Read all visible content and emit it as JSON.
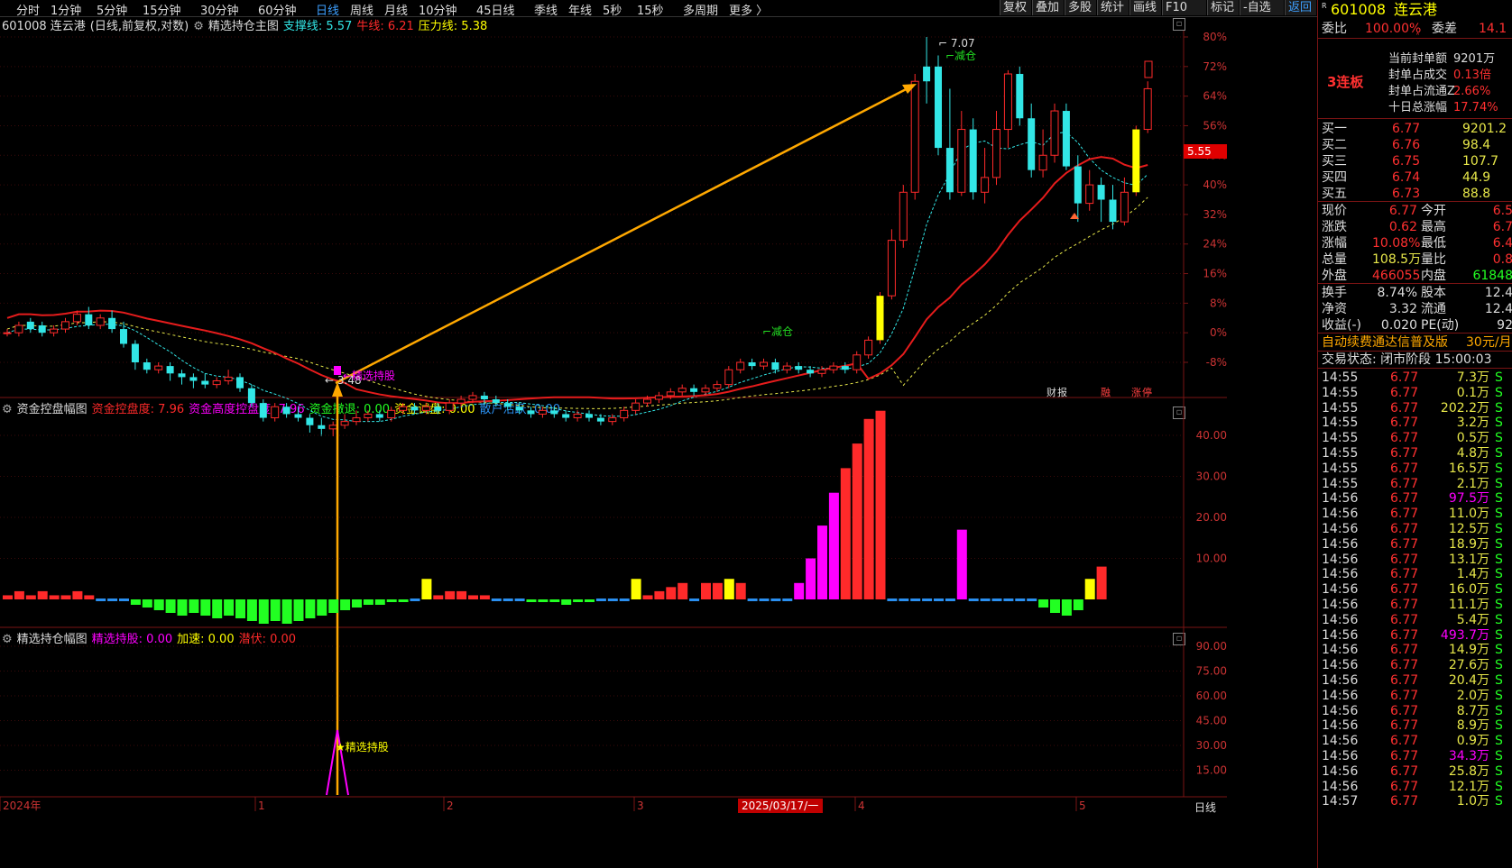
{
  "topbar": {
    "periods": [
      "分时",
      "1分钟",
      "5分钟",
      "15分钟",
      "30分钟",
      "60分钟",
      "日线",
      "周线",
      "月线",
      "10分钟",
      "45日线",
      "季线",
      "年线",
      "5秒",
      "15秒",
      "多周期",
      "更多 〉"
    ],
    "active_period": "日线",
    "tools": [
      "复权",
      "叠加",
      "多股",
      "统计",
      "画线",
      "F10",
      "标记",
      "-自选",
      "返回"
    ]
  },
  "main_title": {
    "stock": "601008 连云港",
    "mode": "(日线,前复权,对数)",
    "indicator": "精选持仓主图",
    "support": "支撑线: 5.57",
    "bull": "牛线: 6.21",
    "pressure": "压力线: 5.38"
  },
  "main_y_labels": [
    "80%",
    "72%",
    "64%",
    "56%",
    "48%",
    "40%",
    "32%",
    "24%",
    "16%",
    "8%",
    "0%",
    "-8%"
  ],
  "current_price_tag": "5.55",
  "annotations": {
    "high": "7.07",
    "low": "3.48",
    "reduce1": "减仓",
    "reduce2": "减仓",
    "hold": "精选持股",
    "icon_caibao": "财",
    "icon_rong": "融",
    "icon_zt": "涨",
    "icon_star": "★精选持股"
  },
  "ind1_title": {
    "name": "资金控盘幅图",
    "a": "资金控盘度: 7.96",
    "b": "资金高度控盘度: 7.96",
    "c": "资金撤退: 0.00",
    "d": "资金试盘: 0.00",
    "e": "散户活跃: 0.00"
  },
  "ind1_y_labels": [
    "40.00",
    "30.00",
    "20.00",
    "10.00"
  ],
  "ind2_title": {
    "name": "精选持仓幅图",
    "a": "精选持股: 0.00",
    "b": "加速: 0.00",
    "c": "潜伏: 0.00"
  },
  "ind2_y_labels": [
    "90.00",
    "75.00",
    "60.00",
    "45.00",
    "30.00",
    "15.00"
  ],
  "x_axis": {
    "labels": [
      "2024年",
      "1",
      "2",
      "3",
      "2025/03/17/一",
      "4",
      "5"
    ],
    "period_label": "日线"
  },
  "colors": {
    "up": "#ff2a2a",
    "down": "#32e6e6",
    "yellow": "#ffff00",
    "magenta": "#ff00ff",
    "green": "#22ff22",
    "blue": "#2a8ff0",
    "gold": "#ffa800",
    "bull": "#e61c1c"
  },
  "chart_data": {
    "type": "candlestick",
    "ma_labels": {
      "support": 5.57,
      "bull": 6.21,
      "pressure": 5.38
    },
    "high": 7.07,
    "low": 3.48,
    "y_pct_ticks": [
      80,
      72,
      64,
      56,
      48,
      40,
      32,
      24,
      16,
      8,
      0,
      -8
    ],
    "candles": [
      [
        0,
        0,
        0,
        1,
        -1,
        1
      ],
      [
        1,
        0,
        2,
        3,
        -1,
        1
      ],
      [
        2,
        3,
        1,
        4,
        0,
        0
      ],
      [
        3,
        2,
        0,
        3,
        -1,
        0
      ],
      [
        4,
        0,
        1,
        2,
        -1,
        1
      ],
      [
        5,
        1,
        3,
        4,
        0,
        1
      ],
      [
        6,
        3,
        5,
        6,
        2,
        1
      ],
      [
        7,
        5,
        2,
        7,
        1,
        0
      ],
      [
        8,
        2,
        4,
        5,
        1,
        1
      ],
      [
        9,
        4,
        1,
        6,
        0,
        0
      ],
      [
        10,
        1,
        -3,
        3,
        -4,
        0
      ],
      [
        11,
        -3,
        -8,
        -2,
        -10,
        0
      ],
      [
        12,
        -8,
        -10,
        -7,
        -11,
        0
      ],
      [
        13,
        -10,
        -9,
        -8,
        -11,
        1
      ],
      [
        14,
        -9,
        -11,
        -8,
        -13,
        0
      ],
      [
        15,
        -11,
        -12,
        -10,
        -14,
        0
      ],
      [
        16,
        -12,
        -13,
        -11,
        -15,
        0
      ],
      [
        17,
        -13,
        -14,
        -11,
        -15,
        0
      ],
      [
        18,
        -14,
        -13,
        -12,
        -15,
        1
      ],
      [
        19,
        -13,
        -12,
        -10,
        -14,
        1
      ],
      [
        20,
        -12,
        -15,
        -11,
        -16,
        0
      ],
      [
        21,
        -15,
        -19,
        -14,
        -20,
        0
      ],
      [
        22,
        -19,
        -23,
        -18,
        -24,
        0
      ],
      [
        23,
        -23,
        -20,
        -19,
        -24,
        1
      ],
      [
        24,
        -20,
        -22,
        -19,
        -23,
        0
      ],
      [
        25,
        -22,
        -23,
        -20,
        -24,
        0
      ],
      [
        26,
        -23,
        -25,
        -22,
        -27,
        0
      ],
      [
        27,
        -25,
        -26,
        -23,
        -28,
        0
      ],
      [
        28,
        -26,
        -25,
        -24,
        -28,
        1
      ],
      [
        29,
        -25,
        -24,
        -22,
        -26,
        1
      ],
      [
        30,
        -24,
        -23,
        -21,
        -25,
        1
      ],
      [
        31,
        -23,
        -22,
        -21,
        -24,
        1
      ],
      [
        32,
        -22,
        -23,
        -21,
        -24,
        0
      ],
      [
        33,
        -23,
        -21,
        -20,
        -24,
        1
      ],
      [
        34,
        -21,
        -20,
        -19,
        -22,
        1
      ],
      [
        35,
        -20,
        -21,
        -19,
        -22,
        0
      ],
      [
        36,
        -21,
        -20,
        -19,
        -22,
        1
      ],
      [
        37,
        -20,
        -21,
        -19,
        -22,
        0
      ],
      [
        38,
        -21,
        -19,
        -18,
        -22,
        1
      ],
      [
        39,
        -19,
        -18,
        -17,
        -20,
        1
      ],
      [
        40,
        -18,
        -17,
        -16,
        -19,
        1
      ],
      [
        41,
        -17,
        -18,
        -16,
        -19,
        0
      ],
      [
        42,
        -18,
        -19,
        -17,
        -20,
        0
      ],
      [
        43,
        -19,
        -20,
        -18,
        -21,
        0
      ],
      [
        44,
        -20,
        -21,
        -19,
        -22,
        0
      ],
      [
        45,
        -21,
        -22,
        -20,
        -23,
        0
      ],
      [
        46,
        -22,
        -21,
        -20,
        -23,
        1
      ],
      [
        47,
        -21,
        -22,
        -20,
        -23,
        0
      ],
      [
        48,
        -22,
        -23,
        -21,
        -24,
        0
      ],
      [
        49,
        -23,
        -22,
        -21,
        -24,
        1
      ],
      [
        50,
        -22,
        -23,
        -21,
        -24,
        0
      ],
      [
        51,
        -23,
        -24,
        -22,
        -25,
        0
      ],
      [
        52,
        -24,
        -23,
        -22,
        -25,
        1
      ],
      [
        53,
        -23,
        -21,
        -20,
        -24,
        1
      ],
      [
        54,
        -21,
        -19,
        -18,
        -22,
        1
      ],
      [
        55,
        -19,
        -18,
        -17,
        -20,
        1
      ],
      [
        56,
        -18,
        -17,
        -16,
        -19,
        1
      ],
      [
        57,
        -17,
        -16,
        -15,
        -18,
        1
      ],
      [
        58,
        -16,
        -15,
        -14,
        -17,
        1
      ],
      [
        59,
        -15,
        -16,
        -14,
        -17,
        0
      ],
      [
        60,
        -16,
        -15,
        -14,
        -17,
        1
      ],
      [
        61,
        -15,
        -14,
        -13,
        -16,
        1
      ],
      [
        62,
        -14,
        -10,
        -9,
        -15,
        1
      ],
      [
        63,
        -10,
        -8,
        -7,
        -11,
        1
      ],
      [
        64,
        -8,
        -9,
        -7,
        -10,
        0
      ],
      [
        65,
        -9,
        -8,
        -7,
        -10,
        1
      ],
      [
        66,
        -8,
        -10,
        -7,
        -11,
        0
      ],
      [
        67,
        -10,
        -9,
        -8,
        -11,
        1
      ],
      [
        68,
        -9,
        -10,
        -8,
        -11,
        0
      ],
      [
        69,
        -10,
        -11,
        -9,
        -12,
        0
      ],
      [
        70,
        -11,
        -10,
        -9,
        -12,
        1
      ],
      [
        71,
        -10,
        -9,
        -8,
        -11,
        1
      ],
      [
        72,
        -9,
        -10,
        -8,
        -11,
        0
      ],
      [
        73,
        -10,
        -6,
        -5,
        -11,
        1
      ],
      [
        74,
        -6,
        -2,
        -1,
        -7,
        1
      ],
      [
        75,
        -2,
        10,
        11,
        -3,
        1
      ],
      [
        76,
        10,
        25,
        28,
        9,
        1
      ],
      [
        77,
        25,
        38,
        40,
        23,
        1
      ],
      [
        78,
        38,
        68,
        70,
        36,
        1
      ],
      [
        79,
        68,
        72,
        80,
        62,
        0
      ],
      [
        80,
        72,
        50,
        75,
        48,
        0
      ],
      [
        81,
        50,
        38,
        66,
        36,
        0
      ],
      [
        82,
        38,
        55,
        60,
        37,
        1
      ],
      [
        83,
        55,
        38,
        58,
        36,
        0
      ],
      [
        84,
        38,
        42,
        50,
        35,
        1
      ],
      [
        85,
        42,
        55,
        60,
        40,
        1
      ],
      [
        86,
        55,
        70,
        71,
        50,
        1
      ],
      [
        87,
        70,
        58,
        72,
        56,
        0
      ],
      [
        88,
        58,
        44,
        62,
        42,
        0
      ],
      [
        89,
        44,
        48,
        55,
        42,
        1
      ],
      [
        90,
        48,
        60,
        62,
        46,
        1
      ],
      [
        91,
        60,
        45,
        62,
        44,
        0
      ],
      [
        92,
        45,
        35,
        48,
        30,
        0
      ],
      [
        93,
        35,
        40,
        44,
        33,
        1
      ],
      [
        94,
        40,
        36,
        42,
        30,
        0
      ],
      [
        95,
        36,
        30,
        40,
        28,
        0
      ],
      [
        96,
        30,
        38,
        42,
        29,
        1
      ],
      [
        97,
        38,
        55,
        56,
        37,
        1
      ],
      [
        98,
        55,
        66,
        68,
        54,
        1
      ]
    ],
    "fund_control_bars": [
      1,
      2,
      1,
      2,
      1,
      1,
      2,
      1,
      0,
      0,
      0,
      -2,
      -3,
      -4,
      -5,
      -6,
      -5,
      -6,
      -7,
      -6,
      -7,
      -8,
      -9,
      -8,
      -9,
      -8,
      -7,
      -6,
      -5,
      -4,
      -3,
      -2,
      -2,
      -1,
      -1,
      0,
      5,
      1,
      2,
      2,
      1,
      1,
      0,
      0,
      0,
      -1,
      -1,
      -1,
      -2,
      -1,
      -1,
      0,
      0,
      0,
      5,
      1,
      2,
      3,
      4,
      0,
      4,
      4,
      5,
      4,
      0,
      0,
      0,
      0,
      4,
      10,
      18,
      26,
      32,
      38,
      44,
      46,
      0,
      0,
      0,
      0,
      0,
      0,
      17,
      0,
      0,
      0,
      0,
      0,
      0,
      -3,
      -5,
      -6,
      -4,
      5,
      8
    ],
    "hold_signal": {
      "peak": 40,
      "label": "精选持股"
    }
  },
  "quote": {
    "code": "601008",
    "name": "连云港",
    "weibi_label": "委比",
    "weibi": "100.00%",
    "weicha_label": "委差",
    "weicha": "14.1",
    "lianban": "3连板",
    "seal": [
      [
        "当前封单额",
        "9201万"
      ],
      [
        "封单占成交",
        "0.13倍"
      ],
      [
        "封单占流通Z",
        "2.66%"
      ],
      [
        "十日总涨幅",
        "17.74%"
      ]
    ],
    "buys": [
      [
        "买一",
        "6.77",
        "9201.2"
      ],
      [
        "买二",
        "6.76",
        "98.4"
      ],
      [
        "买三",
        "6.75",
        "107.7"
      ],
      [
        "买四",
        "6.74",
        "44.9"
      ],
      [
        "买五",
        "6.73",
        "88.8"
      ]
    ],
    "stats": [
      [
        "现价",
        "6.77",
        "今开",
        "6.5"
      ],
      [
        "涨跌",
        "0.62",
        "最高",
        "6.7"
      ],
      [
        "涨幅",
        "10.08%",
        "最低",
        "6.4"
      ],
      [
        "总量",
        "108.5万",
        "量比",
        "0.8"
      ],
      [
        "外盘",
        "466055",
        "内盘",
        "61848"
      ]
    ],
    "stats2": [
      [
        "换手",
        "8.74%",
        "股本",
        "12.4"
      ],
      [
        "净资",
        "3.32",
        "流通",
        "12.4"
      ],
      [
        "收益(-)",
        "0.020",
        "PE(动)",
        "92"
      ]
    ],
    "promo": "自动续费通达信普及版",
    "promo_price": "30元/月",
    "trade_status": "交易状态: 闭市阶段 15:00:03",
    "ticks": [
      [
        "14:55",
        "6.77",
        "7.3万"
      ],
      [
        "14:55",
        "6.77",
        "0.1万"
      ],
      [
        "14:55",
        "6.77",
        "202.2万"
      ],
      [
        "14:55",
        "6.77",
        "3.2万"
      ],
      [
        "14:55",
        "6.77",
        "0.5万"
      ],
      [
        "14:55",
        "6.77",
        "4.8万"
      ],
      [
        "14:55",
        "6.77",
        "16.5万"
      ],
      [
        "14:55",
        "6.77",
        "2.1万"
      ],
      [
        "14:56",
        "6.77",
        "97.5万"
      ],
      [
        "14:56",
        "6.77",
        "11.0万"
      ],
      [
        "14:56",
        "6.77",
        "12.5万"
      ],
      [
        "14:56",
        "6.77",
        "18.9万"
      ],
      [
        "14:56",
        "6.77",
        "13.1万"
      ],
      [
        "14:56",
        "6.77",
        "1.4万"
      ],
      [
        "14:56",
        "6.77",
        "16.0万"
      ],
      [
        "14:56",
        "6.77",
        "11.1万"
      ],
      [
        "14:56",
        "6.77",
        "5.4万"
      ],
      [
        "14:56",
        "6.77",
        "493.7万"
      ],
      [
        "14:56",
        "6.77",
        "14.9万"
      ],
      [
        "14:56",
        "6.77",
        "27.6万"
      ],
      [
        "14:56",
        "6.77",
        "20.4万"
      ],
      [
        "14:56",
        "6.77",
        "2.0万"
      ],
      [
        "14:56",
        "6.77",
        "8.7万"
      ],
      [
        "14:56",
        "6.77",
        "8.9万"
      ],
      [
        "14:56",
        "6.77",
        "0.9万"
      ],
      [
        "14:56",
        "6.77",
        "34.3万"
      ],
      [
        "14:56",
        "6.77",
        "25.8万"
      ],
      [
        "14:56",
        "6.77",
        "12.1万"
      ],
      [
        "14:57",
        "6.77",
        "1.0万"
      ]
    ],
    "tick_flag": "S"
  }
}
